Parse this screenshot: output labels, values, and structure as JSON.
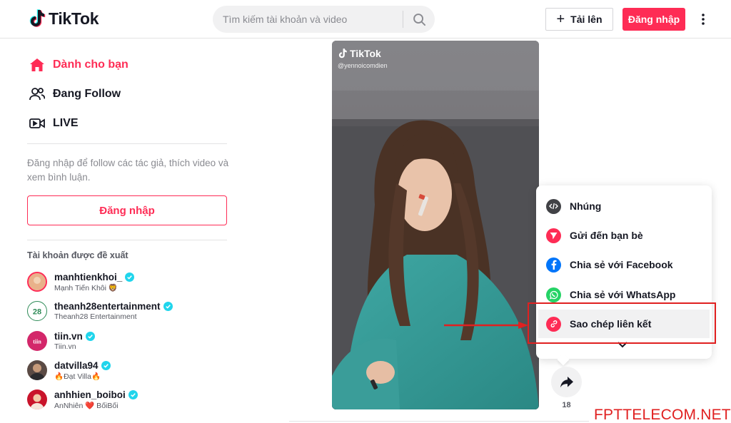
{
  "header": {
    "logo_text": "TikTok",
    "search_placeholder": "Tìm kiếm tài khoản và video",
    "upload_label": "Tải lên",
    "login_label": "Đăng nhập"
  },
  "sidebar": {
    "nav": [
      {
        "label": "Dành cho bạn",
        "icon": "home-icon",
        "active": true
      },
      {
        "label": "Đang Follow",
        "icon": "users-icon",
        "active": false
      },
      {
        "label": "LIVE",
        "icon": "live-icon",
        "active": false
      }
    ],
    "login_hint": "Đăng nhập để follow các tác giả, thích video và xem bình luận.",
    "login_button": "Đăng nhập",
    "suggested_title": "Tài khoản được đề xuất",
    "accounts": [
      {
        "username": "manhtienkhoi_",
        "name": "Mạnh Tiến Khôi 🦁"
      },
      {
        "username": "theanh28entertainment",
        "name": "Theanh28 Entertainment"
      },
      {
        "username": "tiin.vn",
        "name": "Tiin.vn"
      },
      {
        "username": "datvilla94",
        "name": "🔥Đạt Villa🔥"
      },
      {
        "username": "anhhien_boiboi",
        "name": "AnNhiên ❤️ BốiBối"
      }
    ]
  },
  "video": {
    "watermark_logo": "TikTok",
    "watermark_user": "@yennoicomdien"
  },
  "share_menu": {
    "items": [
      {
        "label": "Nhúng",
        "icon": "embed-icon",
        "color": "#414246"
      },
      {
        "label": "Gửi đến bạn bè",
        "icon": "send-icon",
        "color": "#fe2c55"
      },
      {
        "label": "Chia sẻ với Facebook",
        "icon": "facebook-icon",
        "color": "#0075fa"
      },
      {
        "label": "Chia sẻ với WhatsApp",
        "icon": "whatsapp-icon",
        "color": "#25d366"
      },
      {
        "label": "Sao chép liên kết",
        "icon": "link-icon",
        "color": "#fe2c55"
      }
    ]
  },
  "share_count": "18",
  "watermark_site": "FPTTELECOM.NET",
  "colors": {
    "accent": "#fe2c55",
    "annotation": "#e02020"
  }
}
